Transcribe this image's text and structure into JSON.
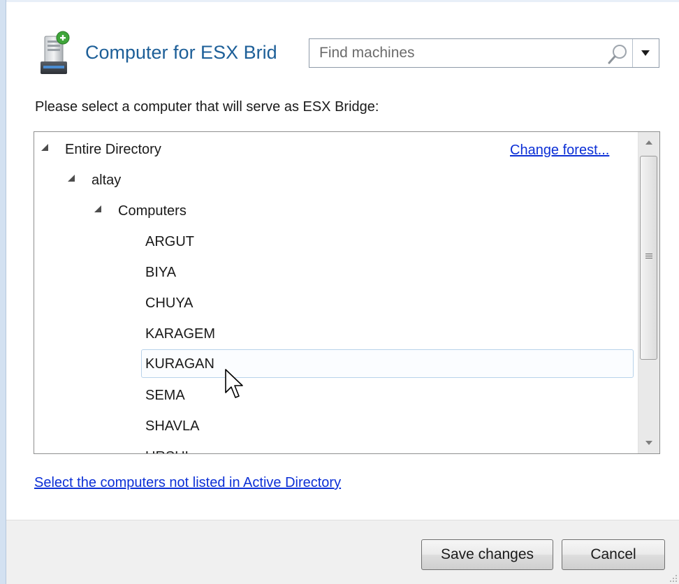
{
  "window": {
    "title": "Computer for ESX Brid"
  },
  "search": {
    "placeholder": "Find machines",
    "value": ""
  },
  "prompt": "Please select a computer that will serve as ESX Bridge:",
  "tree": {
    "change_forest_label": "Change forest...",
    "root": {
      "label": "Entire Directory",
      "expanded": true
    },
    "domain": {
      "label": "altay",
      "expanded": true
    },
    "container": {
      "label": "Computers",
      "expanded": true
    },
    "computers": [
      {
        "label": "ARGUT"
      },
      {
        "label": "BIYA"
      },
      {
        "label": "CHUYA"
      },
      {
        "label": "KARAGEM"
      },
      {
        "label": "KURAGAN",
        "hovered": true
      },
      {
        "label": "SEMA"
      },
      {
        "label": "SHAVLA"
      },
      {
        "label": "URSUL"
      }
    ]
  },
  "not_listed_link": "Select the computers not listed in Active Directory",
  "buttons": {
    "save": "Save changes",
    "cancel": "Cancel"
  },
  "colors": {
    "title": "#1d5f98",
    "link": "#0b2fd6",
    "footer_bg": "#f0f0f0",
    "hover_outline": "#b8d2ea"
  },
  "icons": {
    "app": "server-add-icon",
    "search": "search-icon",
    "dropdown": "chevron-down-icon"
  }
}
